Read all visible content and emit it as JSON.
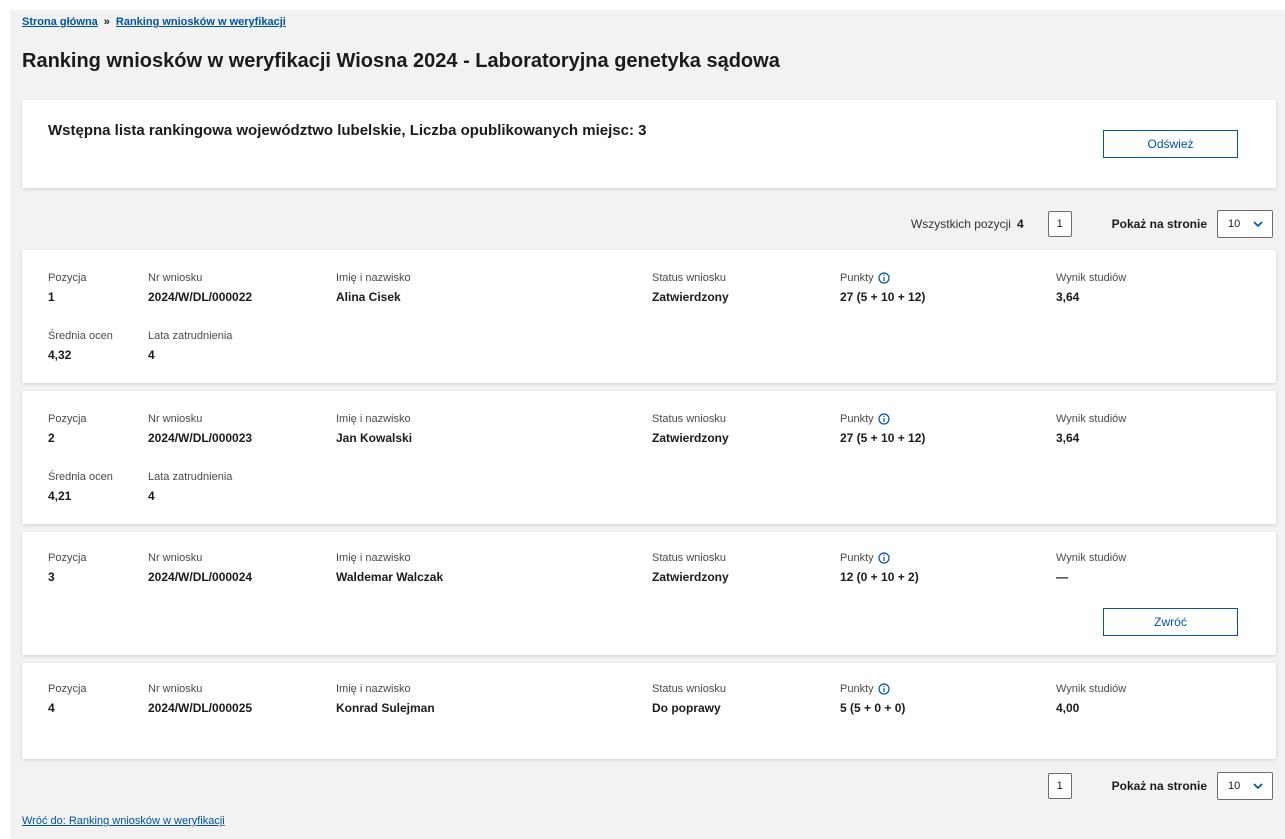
{
  "breadcrumb": {
    "home": "Strona główna",
    "separator": "»",
    "current": "Ranking wniosków w weryfikacji"
  },
  "title": "Ranking wniosków w weryfikacji Wiosna 2024 - Laboratoryjna genetyka sądowa",
  "info": {
    "heading": "Wstępna lista rankingowa województwo lubelskie, Liczba opublikowanych miejsc: 3",
    "refresh_label": "Odśwież"
  },
  "pager": {
    "total_label": "Wszystkich pozycji",
    "total_value": "4",
    "page": "1",
    "per_page_label": "Pokaż na stronie",
    "per_page_value": "10"
  },
  "labels": {
    "position": "Pozycja",
    "number": "Nr wniosku",
    "name": "Imię i nazwisko",
    "status": "Status wniosku",
    "points": "Punkty",
    "study_result": "Wynik studiów",
    "avg_grade": "Średnia ocen",
    "employment_years": "Lata zatrudnienia"
  },
  "rows": [
    {
      "position": "1",
      "number": "2024/W/DL/000022",
      "name": "Alina Cisek",
      "status": "Zatwierdzony",
      "points": "27 (5 + 10 + 12)",
      "study_result": "3,64",
      "avg_grade": "4,32",
      "employment_years": "4"
    },
    {
      "position": "2",
      "number": "2024/W/DL/000023",
      "name": "Jan Kowalski",
      "status": "Zatwierdzony",
      "points": "27 (5 + 10 + 12)",
      "study_result": "3,64",
      "avg_grade": "4,21",
      "employment_years": "4"
    },
    {
      "position": "3",
      "number": "2024/W/DL/000024",
      "name": "Waldemar Walczak",
      "status": "Zatwierdzony",
      "points": "12 (0 + 10 + 2)",
      "study_result": "—",
      "action_label": "Zwróć"
    },
    {
      "position": "4",
      "number": "2024/W/DL/000025",
      "name": "Konrad Sulejman",
      "status": "Do poprawy",
      "points": "5 (5 + 0 + 0)",
      "study_result": "4,00"
    }
  ],
  "footer_link": "Wróć do: Ranking wniosków w weryfikacji",
  "colors": {
    "accent": "#0052a5",
    "background": "#f2f2f2",
    "card": "#ffffff"
  },
  "icons": {
    "info": "info-circle-icon",
    "chevron": "chevron-down-icon"
  }
}
